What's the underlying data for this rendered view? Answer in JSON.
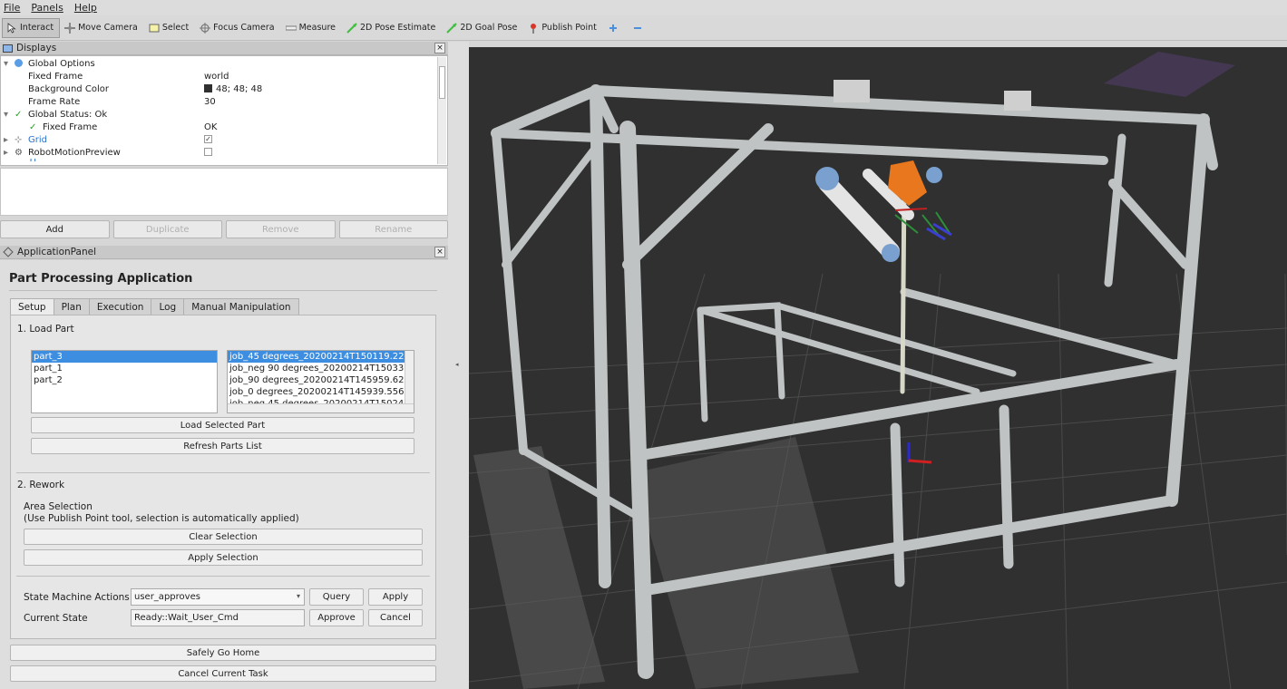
{
  "menu": [
    "File",
    "Panels",
    "Help"
  ],
  "toolbar": [
    {
      "label": "Interact",
      "icon": "cursor-icon",
      "active": true
    },
    {
      "label": "Move Camera",
      "icon": "move-camera-icon"
    },
    {
      "label": "Select",
      "icon": "select-icon"
    },
    {
      "label": "Focus Camera",
      "icon": "focus-camera-icon"
    },
    {
      "label": "Measure",
      "icon": "ruler-icon"
    },
    {
      "label": "2D Pose Estimate",
      "icon": "pose-estimate-icon"
    },
    {
      "label": "2D Goal Pose",
      "icon": "goal-pose-icon"
    },
    {
      "label": "Publish Point",
      "icon": "pin-icon"
    }
  ],
  "displays": {
    "title": "Displays",
    "rows": [
      {
        "name": "Global Options",
        "value": ""
      },
      {
        "name": "Fixed Frame",
        "value": "world"
      },
      {
        "name": "Background Color",
        "value": "48; 48; 48"
      },
      {
        "name": "Frame Rate",
        "value": "30"
      },
      {
        "name": "Global Status: Ok",
        "value": ""
      },
      {
        "name": "Fixed Frame",
        "value": "OK"
      },
      {
        "name": "Grid",
        "value": ""
      },
      {
        "name": "RobotMotionPreview",
        "value": ""
      },
      {
        "name": "TF",
        "value": ""
      }
    ],
    "buttons": [
      "Add",
      "Duplicate",
      "Remove",
      "Rename"
    ]
  },
  "app": {
    "panel_title": "ApplicationPanel",
    "title": "Part Processing Application",
    "tabs": [
      "Setup",
      "Plan",
      "Execution",
      "Log",
      "Manual Manipulation"
    ],
    "load_part": {
      "heading": "1. Load Part",
      "parts": [
        "part_3",
        "part_1",
        "part_2"
      ],
      "jobs": [
        "job_45 degrees_20200214T150119.22",
        "job_neg 90 degrees_20200214T15033",
        "job_90 degrees_20200214T145959.62",
        "job_0 degrees_20200214T145939.556",
        "job_neg 45 degrees_20200214T15024"
      ],
      "load_button": "Load Selected Part",
      "refresh_button": "Refresh Parts List"
    },
    "rework": {
      "heading": "2. Rework",
      "area_label": "Area Selection",
      "area_hint": "(Use Publish Point tool, selection is automatically applied)",
      "clear_button": "Clear Selection",
      "apply_button": "Apply Selection"
    },
    "state": {
      "actions_label": "State Machine Actions",
      "actions_value": "user_approves",
      "query_button": "Query",
      "apply_button": "Apply",
      "current_label": "Current State",
      "current_value": "Ready::Wait_User_Cmd",
      "approve_button": "Approve",
      "cancel_button": "Cancel"
    },
    "home_button": "Safely Go Home",
    "cancel_task_button": "Cancel Current Task"
  },
  "colors": {
    "viewport_bg": "#303030",
    "selection": "#3d8ee0",
    "robot_orange": "#e8771e",
    "frame_gray": "#bfc3c4"
  }
}
